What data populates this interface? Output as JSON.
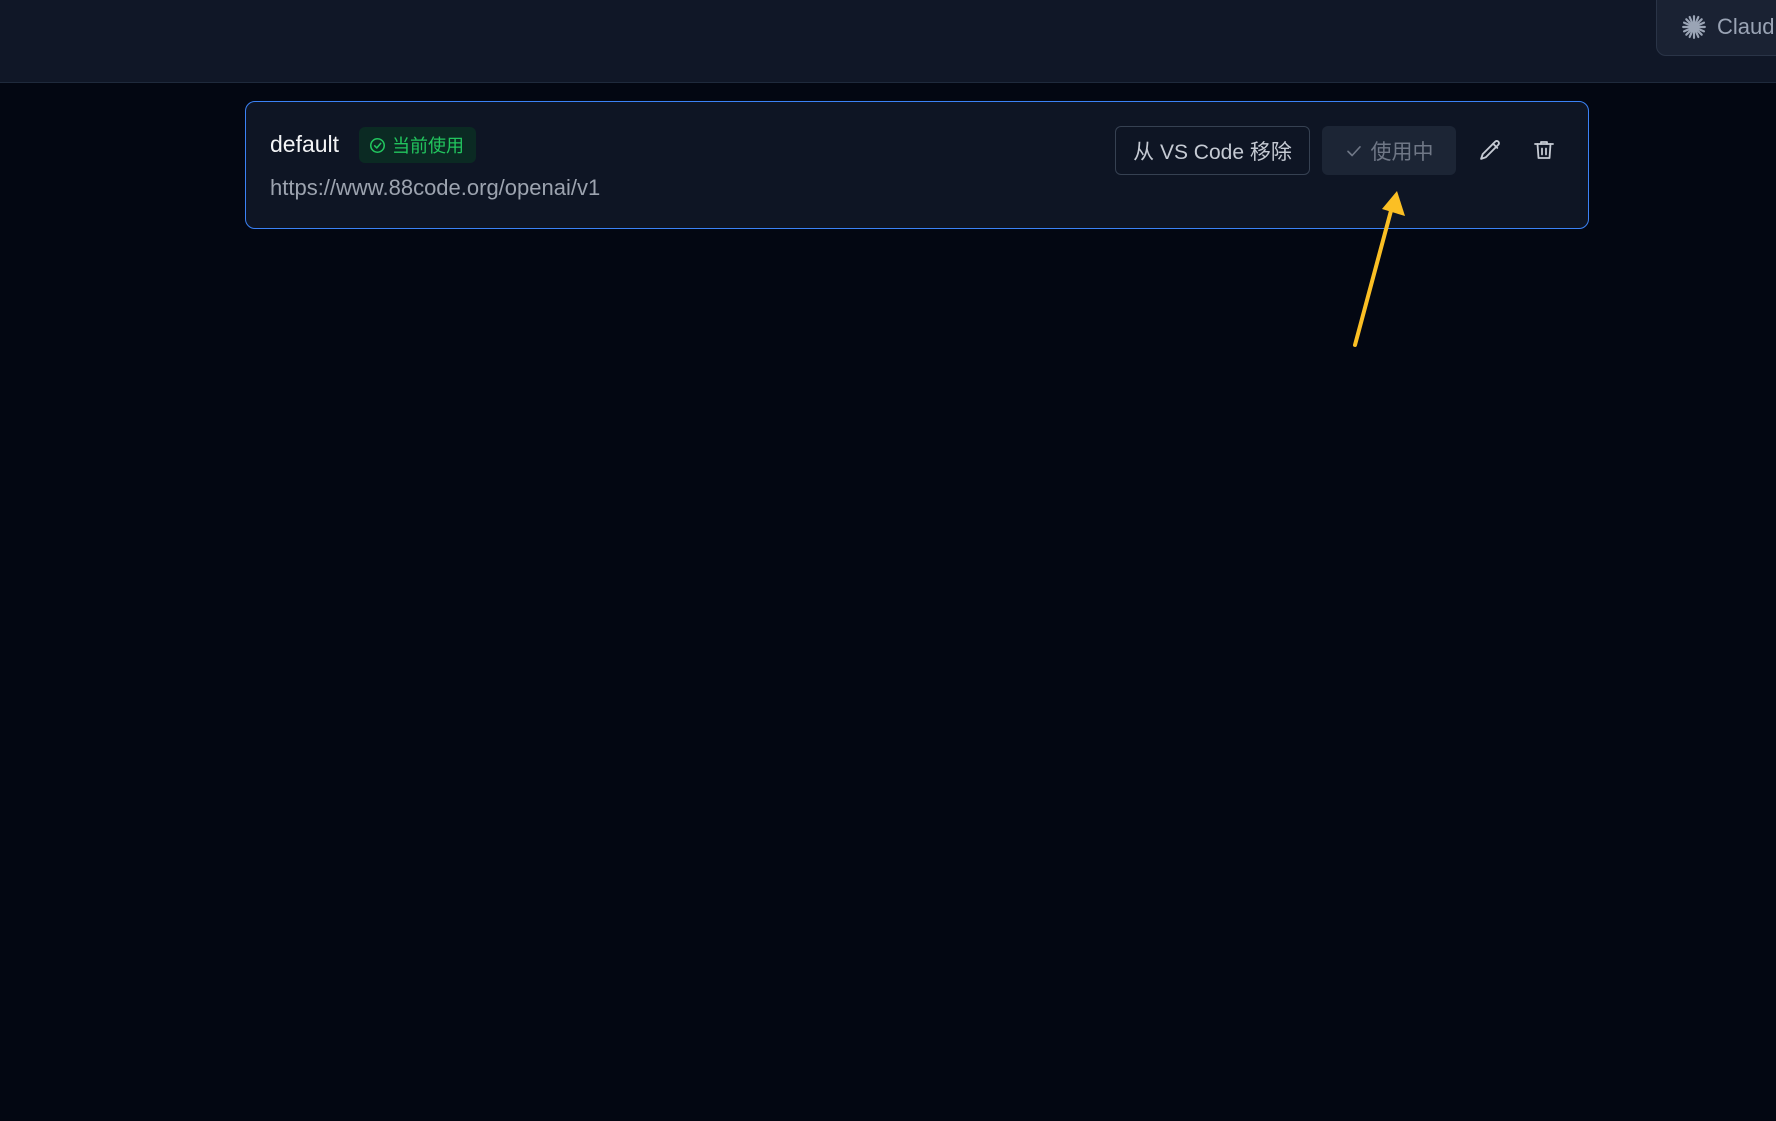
{
  "header": {
    "product_tab": {
      "label": "Claud",
      "icon": "claude-sparkle-icon"
    }
  },
  "profile_card": {
    "name": "default",
    "status_badge": {
      "label": "当前使用",
      "icon": "check-circle-icon",
      "color": "#22c55e"
    },
    "url": "https://www.88code.org/openai/v1",
    "remove_button_label": "从 VS Code 移除",
    "in_use_button": {
      "label": "使用中",
      "icon": "check-icon"
    },
    "edit_icon": "pencil-icon",
    "delete_icon": "trash-icon",
    "accent_color": "#3b82f6"
  },
  "annotation": {
    "type": "arrow",
    "color": "#fbbf24",
    "points_to": "in-use-button"
  }
}
